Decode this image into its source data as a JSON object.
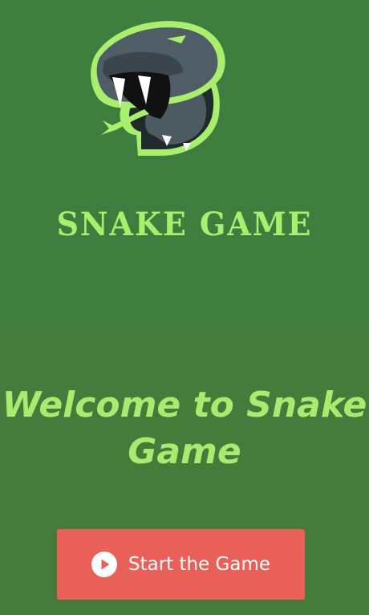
{
  "hero": {
    "title": "SNAKE GAME",
    "logo_icon": "snake-head-icon"
  },
  "main": {
    "welcome": "Welcome to Snake Game",
    "start_button": {
      "label": "Start the Game",
      "icon": "play-circle-icon"
    }
  },
  "colors": {
    "hero_background": "#3d7e3e",
    "page_background": "#477b3b",
    "accent_green": "#a9ee6c",
    "button": "#e86058",
    "button_text": "#ffffff"
  }
}
